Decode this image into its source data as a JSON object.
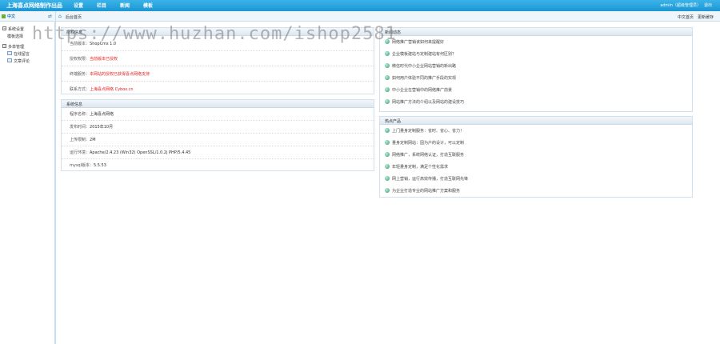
{
  "app": {
    "title": "上海喜点网络制作出品"
  },
  "nav": [
    "设置",
    "栏目",
    "新闻",
    "模板"
  ],
  "user": {
    "info": "admin（超级管理员）",
    "logout": "退出"
  },
  "subbar": {
    "lang": "中文",
    "breadcrumb": "后台首页",
    "right_links": [
      "中文首页",
      "更新缓存"
    ]
  },
  "sidebar": {
    "groups": [
      {
        "label": "系统设置",
        "items": [
          "模板选择"
        ]
      },
      {
        "label": "多单管理",
        "items": [
          "在线留言",
          "文章评论"
        ]
      }
    ]
  },
  "license_panel": {
    "title": "授权信息",
    "rows": [
      {
        "key": "当前版本：",
        "value": "ShopCms 1.0"
      },
      {
        "key": "授权权限：",
        "value": "当前版本已授权"
      },
      {
        "key": "终端服务：",
        "value": "本网站的授权已获得喜点网络支持"
      },
      {
        "key": "联系方式：",
        "value": "上海喜点网络 Cybox.cn"
      }
    ]
  },
  "system_panel": {
    "title": "系统信息",
    "rows": [
      {
        "key": "程序名称：",
        "value": "上海喜点网络"
      },
      {
        "key": "发布时间：",
        "value": "2015年10月"
      },
      {
        "key": "上传限制：",
        "value": "2M"
      },
      {
        "key": "运行环境：",
        "value": "Apache/2.4.23 (Win32) OpenSSL/1.0.2j PHP/5.4.45"
      },
      {
        "key": "mysql版本：",
        "value": "5.5.53"
      }
    ]
  },
  "news_panel": {
    "title": "新闻动态",
    "items": [
      "网络推广营销该如何来提醒好",
      "企业模板建站与定制建站有何区别？",
      "微信时代中小企业网站营销的新出路",
      "如何用户体验不同的推广手段的实现",
      "中小企业在营销中的网络推广前景",
      "网站推广方法的介绍以及网站的建设技巧"
    ]
  },
  "product_panel": {
    "title": "热点产品",
    "items": [
      "上门量身定制服务：省时、省心、省力！",
      "量身定制网站：因为户的设计，可以定制",
      "网络推广，系统网络认证，打造互联服务",
      "年轻量身定制，满足个性化需求",
      "网上营销，运行高效传播，打造互联网先锋",
      "为企业打造专业的网站推广方案和服务"
    ]
  },
  "watermark": "https://www.huzhan.com/ishop2581"
}
